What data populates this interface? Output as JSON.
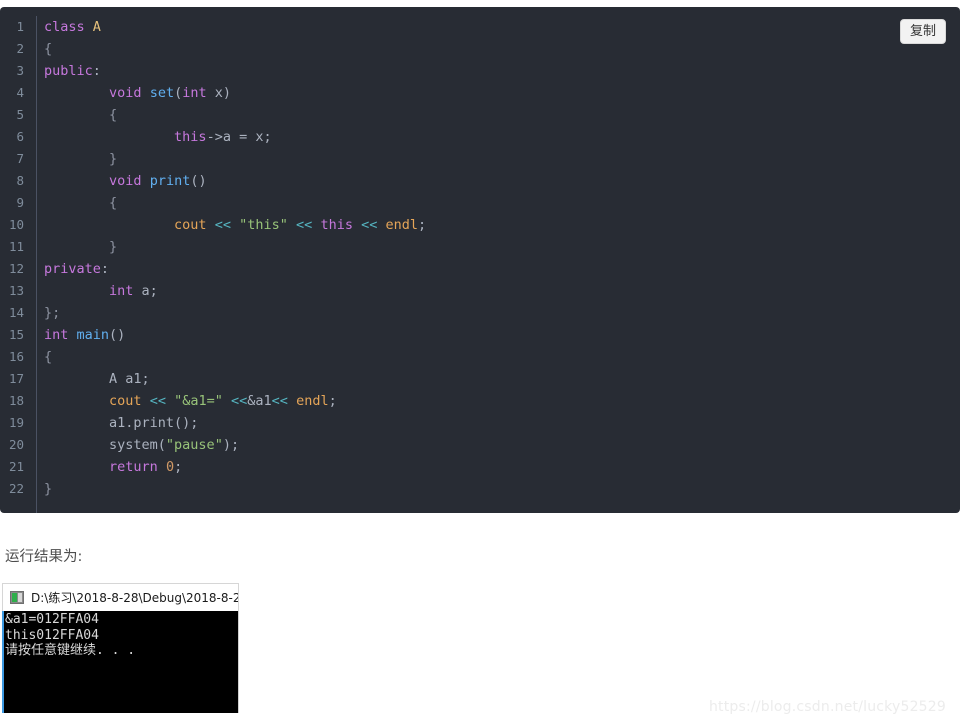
{
  "theme": {
    "code_bg": "#282c34",
    "page_bg": "#ffffff",
    "gutter_color": "#7f8c9b",
    "keyword_color": "#c678dd",
    "string_color": "#98c379",
    "function_color": "#61afef",
    "builtin_color": "#e5a558",
    "class_color": "#e5c07b",
    "console_bg": "#000000",
    "console_accent": "#3d9ae2"
  },
  "code_block": {
    "copy_button_label": "复制",
    "language": "cpp",
    "lines": [
      {
        "n": "1",
        "tokens": [
          {
            "t": "class",
            "c": "t-kw"
          },
          {
            "t": " ",
            "c": "t-pn"
          },
          {
            "t": "A",
            "c": "t-cls"
          }
        ]
      },
      {
        "n": "2",
        "tokens": [
          {
            "t": "{",
            "c": "t-brc"
          }
        ]
      },
      {
        "n": "3",
        "tokens": [
          {
            "t": "public",
            "c": "t-kw"
          },
          {
            "t": ":",
            "c": "t-pn"
          }
        ]
      },
      {
        "n": "4",
        "tokens": [
          {
            "t": "        ",
            "c": "t-pn"
          },
          {
            "t": "void",
            "c": "t-kw"
          },
          {
            "t": " ",
            "c": "t-pn"
          },
          {
            "t": "set",
            "c": "t-fn"
          },
          {
            "t": "(",
            "c": "t-pn"
          },
          {
            "t": "int",
            "c": "t-kw"
          },
          {
            "t": " x)",
            "c": "t-pn"
          }
        ]
      },
      {
        "n": "5",
        "tokens": [
          {
            "t": "        ",
            "c": "t-pn"
          },
          {
            "t": "{",
            "c": "t-brc"
          }
        ]
      },
      {
        "n": "6",
        "tokens": [
          {
            "t": "                ",
            "c": "t-pn"
          },
          {
            "t": "this",
            "c": "t-kw"
          },
          {
            "t": "->a = x;",
            "c": "t-pn"
          }
        ]
      },
      {
        "n": "7",
        "tokens": [
          {
            "t": "        ",
            "c": "t-pn"
          },
          {
            "t": "}",
            "c": "t-brc"
          }
        ]
      },
      {
        "n": "8",
        "tokens": [
          {
            "t": "        ",
            "c": "t-pn"
          },
          {
            "t": "void",
            "c": "t-kw"
          },
          {
            "t": " ",
            "c": "t-pn"
          },
          {
            "t": "print",
            "c": "t-fn"
          },
          {
            "t": "()",
            "c": "t-pn"
          }
        ]
      },
      {
        "n": "9",
        "tokens": [
          {
            "t": "        ",
            "c": "t-pn"
          },
          {
            "t": "{",
            "c": "t-brc"
          }
        ]
      },
      {
        "n": "10",
        "tokens": [
          {
            "t": "                ",
            "c": "t-pn"
          },
          {
            "t": "cout",
            "c": "t-bi"
          },
          {
            "t": " ",
            "c": "t-pn"
          },
          {
            "t": "<<",
            "c": "t-op"
          },
          {
            "t": " ",
            "c": "t-pn"
          },
          {
            "t": "\"this\"",
            "c": "t-str"
          },
          {
            "t": " ",
            "c": "t-pn"
          },
          {
            "t": "<<",
            "c": "t-op"
          },
          {
            "t": " ",
            "c": "t-pn"
          },
          {
            "t": "this",
            "c": "t-kw"
          },
          {
            "t": " ",
            "c": "t-pn"
          },
          {
            "t": "<<",
            "c": "t-op"
          },
          {
            "t": " ",
            "c": "t-pn"
          },
          {
            "t": "endl",
            "c": "t-bi"
          },
          {
            "t": ";",
            "c": "t-pn"
          }
        ]
      },
      {
        "n": "11",
        "tokens": [
          {
            "t": "        ",
            "c": "t-pn"
          },
          {
            "t": "}",
            "c": "t-brc"
          }
        ]
      },
      {
        "n": "12",
        "tokens": [
          {
            "t": "private",
            "c": "t-kw"
          },
          {
            "t": ":",
            "c": "t-pn"
          }
        ]
      },
      {
        "n": "13",
        "tokens": [
          {
            "t": "        ",
            "c": "t-pn"
          },
          {
            "t": "int",
            "c": "t-kw"
          },
          {
            "t": " a;",
            "c": "t-pn"
          }
        ]
      },
      {
        "n": "14",
        "tokens": [
          {
            "t": "};",
            "c": "t-brc"
          }
        ]
      },
      {
        "n": "15",
        "tokens": [
          {
            "t": "int",
            "c": "t-kw"
          },
          {
            "t": " ",
            "c": "t-pn"
          },
          {
            "t": "main",
            "c": "t-fn"
          },
          {
            "t": "()",
            "c": "t-pn"
          }
        ]
      },
      {
        "n": "16",
        "tokens": [
          {
            "t": "{",
            "c": "t-brc"
          }
        ]
      },
      {
        "n": "17",
        "tokens": [
          {
            "t": "        A a1;",
            "c": "t-pn"
          }
        ]
      },
      {
        "n": "18",
        "tokens": [
          {
            "t": "        ",
            "c": "t-pn"
          },
          {
            "t": "cout",
            "c": "t-bi"
          },
          {
            "t": " ",
            "c": "t-pn"
          },
          {
            "t": "<<",
            "c": "t-op"
          },
          {
            "t": " ",
            "c": "t-pn"
          },
          {
            "t": "\"&a1=\"",
            "c": "t-str"
          },
          {
            "t": " ",
            "c": "t-pn"
          },
          {
            "t": "<<",
            "c": "t-op"
          },
          {
            "t": "&a1",
            "c": "t-pn"
          },
          {
            "t": "<<",
            "c": "t-op"
          },
          {
            "t": " ",
            "c": "t-pn"
          },
          {
            "t": "endl",
            "c": "t-bi"
          },
          {
            "t": ";",
            "c": "t-pn"
          }
        ]
      },
      {
        "n": "19",
        "tokens": [
          {
            "t": "        a1.print();",
            "c": "t-pn"
          }
        ]
      },
      {
        "n": "20",
        "tokens": [
          {
            "t": "        system(",
            "c": "t-pn"
          },
          {
            "t": "\"pause\"",
            "c": "t-str"
          },
          {
            "t": ");",
            "c": "t-pn"
          }
        ]
      },
      {
        "n": "21",
        "tokens": [
          {
            "t": "        ",
            "c": "t-pn"
          },
          {
            "t": "return",
            "c": "t-kw"
          },
          {
            "t": " ",
            "c": "t-pn"
          },
          {
            "t": "0",
            "c": "t-num"
          },
          {
            "t": ";",
            "c": "t-pn"
          }
        ]
      },
      {
        "n": "22",
        "tokens": [
          {
            "t": "}",
            "c": "t-brc"
          }
        ]
      }
    ]
  },
  "article": {
    "result_label": "运行结果为:"
  },
  "console": {
    "title": "D:\\练习\\2018-8-28\\Debug\\2018-8-2",
    "icon": "console-app-icon",
    "output_lines": [
      "&a1=012FFA04",
      "this012FFA04",
      "请按任意键继续. . ."
    ]
  },
  "watermark": {
    "text": "https://blog.csdn.net/lucky52529"
  }
}
